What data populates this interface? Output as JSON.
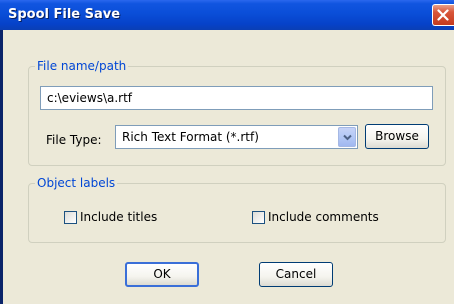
{
  "window": {
    "title": "Spool File Save"
  },
  "file_group": {
    "label": "File name/path",
    "path_value": "c:\\eviews\\a.rtf",
    "file_type_label": "File Type:",
    "file_type_value": "Rich Text Format (*.rtf)",
    "browse_label": "Browse"
  },
  "labels_group": {
    "label": "Object labels",
    "include_titles_label": "Include titles",
    "include_titles_checked": false,
    "include_comments_label": "Include comments",
    "include_comments_checked": false
  },
  "buttons": {
    "ok_label": "OK",
    "cancel_label": "Cancel"
  },
  "colors": {
    "titlebar": "#0a4ed8",
    "dialog_bg": "#ece9d8",
    "group_label": "#0046d5",
    "close_button": "#d9563a"
  },
  "icons": {
    "close": "close-icon",
    "dropdown": "chevron-down-icon"
  }
}
